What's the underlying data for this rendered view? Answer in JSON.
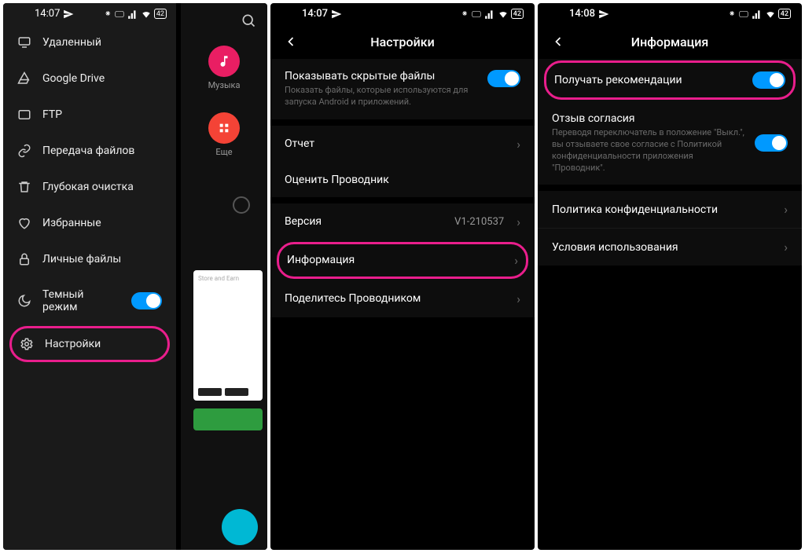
{
  "status": {
    "time1": "14:07",
    "time2": "14:07",
    "time3": "14:08",
    "battery": "42"
  },
  "phone1": {
    "bg": {
      "music_label": "Музыка",
      "more_label": "Еще",
      "card_text": "Store and Earn"
    },
    "drawer": [
      {
        "label": "Удаленный"
      },
      {
        "label": "Google Drive"
      },
      {
        "label": "FTP"
      },
      {
        "label": "Передача файлов"
      },
      {
        "label": "Глубокая очистка"
      },
      {
        "label": "Избранные"
      },
      {
        "label": "Личные файлы"
      },
      {
        "label": "Темный режим"
      },
      {
        "label": "Настройки"
      }
    ]
  },
  "phone2": {
    "title": "Настройки",
    "items": {
      "hidden_title": "Показывать скрытые файлы",
      "hidden_sub": "Показать файлы, которые используются для запуска Android и приложений.",
      "report": "Отчет",
      "rate": "Оценить Проводник",
      "version_label": "Версия",
      "version_value": "V1-210537",
      "info": "Информация",
      "share": "Поделитесь Проводником"
    }
  },
  "phone3": {
    "title": "Информация",
    "items": {
      "recommend": "Получать рекомендации",
      "consent_title": "Отзыв согласия",
      "consent_sub": "Переводя переключатель в положение \"Выкл.\", вы отзываете свое согласие с Политикой конфиденциальности приложения \"Проводник\".",
      "privacy": "Политика конфиденциальности",
      "terms": "Условия использования"
    }
  }
}
